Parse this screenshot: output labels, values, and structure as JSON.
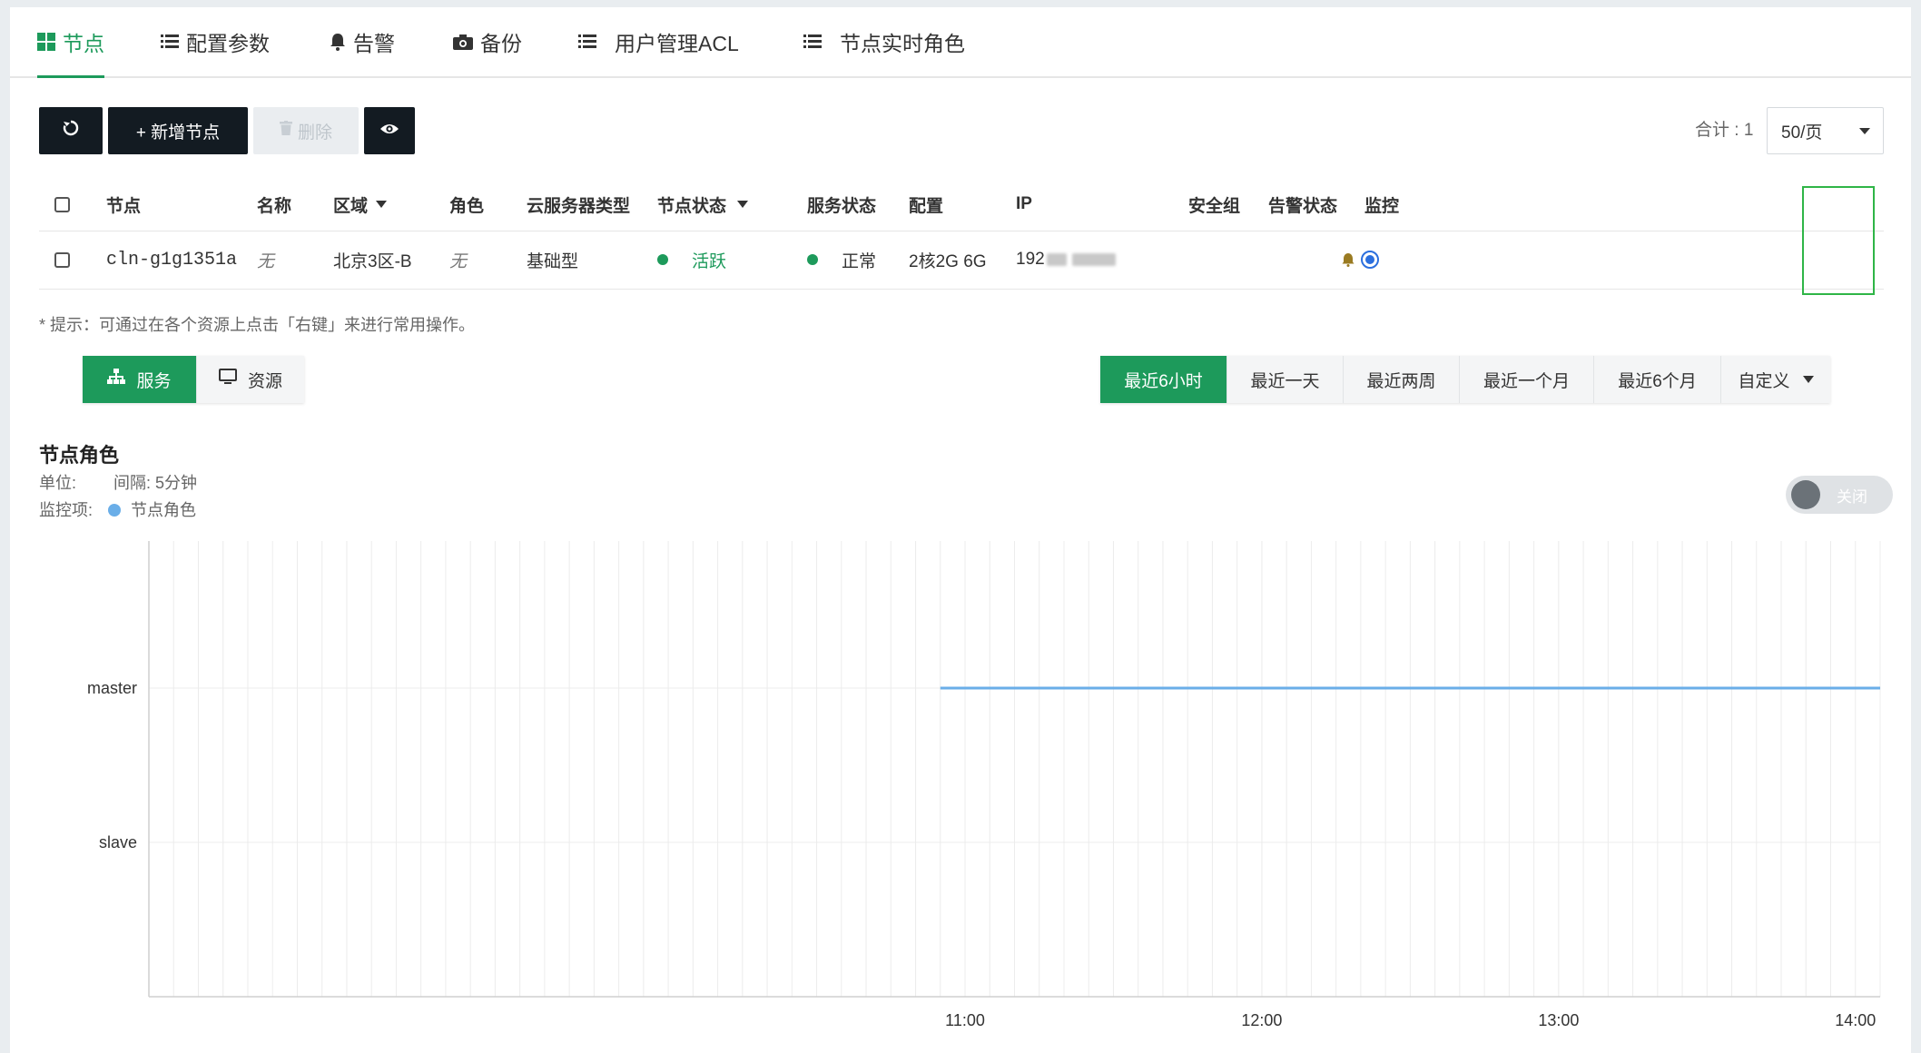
{
  "tabs": [
    {
      "label": "节点",
      "icon": "grid-icon",
      "active": true
    },
    {
      "label": "配置参数",
      "icon": "list-icon",
      "active": false
    },
    {
      "label": "告警",
      "icon": "bell-icon",
      "active": false
    },
    {
      "label": "备份",
      "icon": "camera-icon",
      "active": false
    },
    {
      "label": "用户管理ACL",
      "icon": "list-icon",
      "active": false
    },
    {
      "label": "节点实时角色",
      "icon": "list-icon",
      "active": false
    }
  ],
  "toolbar": {
    "refresh_icon": "refresh-icon",
    "add_label": "+ 新增节点",
    "delete_label": "删除",
    "view_icon": "eye-icon",
    "total_label": "合计 : 1",
    "page_size": "50/页"
  },
  "table": {
    "headers": {
      "node": "节点",
      "name": "名称",
      "region": "区域",
      "role": "角色",
      "server_type": "云服务器类型",
      "node_status": "节点状态",
      "service_status": "服务状态",
      "config": "配置",
      "ip": "IP",
      "security_group": "安全组",
      "alarm_status": "告警状态",
      "monitor": "监控"
    },
    "rows": [
      {
        "node": "cln-g1g1351a",
        "name": "无",
        "region": "北京3区-B",
        "role": "无",
        "server_type": "基础型",
        "node_status": "活跃",
        "service_status": "正常",
        "config": "2核2G 6G",
        "ip_visible": "192",
        "security_group": "",
        "alarm_icon": "bell-icon",
        "monitor_selected": true
      }
    ]
  },
  "hint": "* 提示：可通过在各个资源上点击「右键」来进行常用操作。",
  "view_switch": [
    {
      "label": "服务",
      "icon": "sitemap-icon",
      "active": true
    },
    {
      "label": "资源",
      "icon": "monitor-icon",
      "active": false
    }
  ],
  "time_ranges": [
    {
      "label": "最近6小时",
      "active": true
    },
    {
      "label": "最近一天",
      "active": false
    },
    {
      "label": "最近两周",
      "active": false
    },
    {
      "label": "最近一个月",
      "active": false
    },
    {
      "label": "最近6个月",
      "active": false
    },
    {
      "label": "自定义",
      "active": false,
      "dropdown": true
    }
  ],
  "chart_section": {
    "title": "节点角色",
    "unit_label": "单位:",
    "interval_label": "间隔: 5分钟",
    "monitor_label": "监控项:",
    "legend": "节点角色",
    "toggle_label": "关闭"
  },
  "colors": {
    "accent": "#1d9a5b",
    "series": "#6aaee8",
    "highlight": "#2fb547",
    "dark_button": "#131b22"
  },
  "chart_data": {
    "type": "line",
    "title": "节点角色",
    "y_categories": [
      "slave",
      "master"
    ],
    "x_ticks": [
      "11:00",
      "12:00",
      "13:00",
      "14:00"
    ],
    "x_range": [
      "08:15",
      "14:05"
    ],
    "series": [
      {
        "name": "节点角色",
        "x": [
          "10:55",
          "14:05"
        ],
        "y": [
          "master",
          "master"
        ]
      }
    ],
    "grid": true
  }
}
